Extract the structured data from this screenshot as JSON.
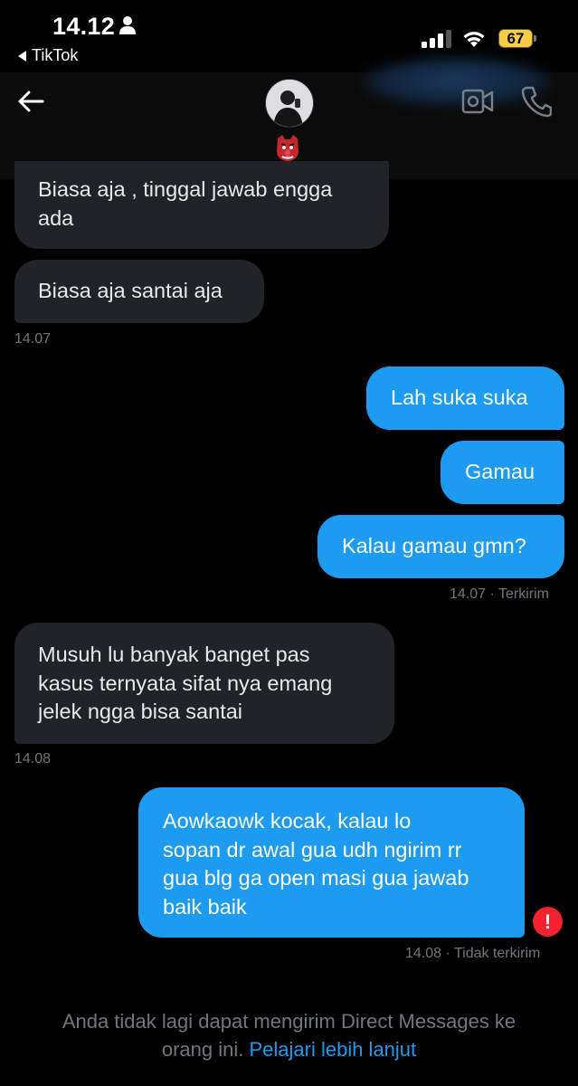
{
  "status_bar": {
    "time": "14.12",
    "back_app": "TikTok",
    "battery": "67"
  },
  "header": {
    "icons": [
      "back-arrow-icon",
      "video-call-icon",
      "phone-call-icon"
    ],
    "mask_emoji": "👺"
  },
  "colors": {
    "incoming_bubble": "#202327",
    "outgoing_bubble": "#1d9bf0",
    "meta_text": "#71767b",
    "link": "#1d9bf0",
    "error": "#f4212e"
  },
  "messages": {
    "m1": {
      "lines": [
        "Biasa aja , tinggal jawab engga",
        "ada"
      ]
    },
    "m2": {
      "text": "Biasa aja santai aja"
    },
    "t1": "14.07",
    "m3": {
      "text": "Lah suka suka"
    },
    "m4": {
      "text": "Gamau"
    },
    "m5": {
      "text": "Kalau gamau gmn?"
    },
    "t2": "14.07 · Terkirim",
    "m6": {
      "lines": [
        "Musuh lu banyak banget pas",
        "kasus ternyata sifat nya emang",
        "jelek ngga bisa santai"
      ]
    },
    "t3": "14.08",
    "m7": {
      "lines": [
        "Aowkaowk kocak, kalau lo",
        "sopan dr awal gua udh ngirim rr",
        "gua blg ga open masi gua jawab",
        "baik baik"
      ]
    },
    "t4": "14.08 · Tidak terkirim",
    "error_mark": "!"
  },
  "footer": {
    "line1": "Anda tidak lagi dapat mengirim Direct Messages ke",
    "line2_prefix": "orang ini.",
    "link": "Pelajari lebih lanjut"
  }
}
